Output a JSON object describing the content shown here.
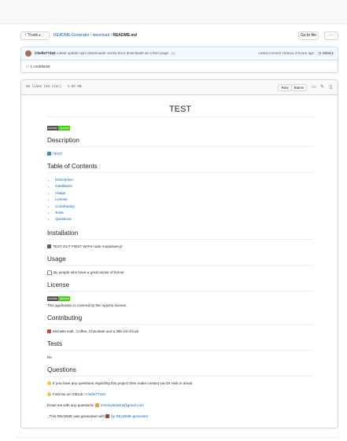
{
  "breadcrumb": {
    "branch_label": "Trunk",
    "repo": "README-Generator",
    "folder": "download",
    "file": "README.md",
    "separator": "/"
  },
  "toolbar": {
    "go_to_file": "Go to file",
    "more": "···"
  },
  "commit": {
    "author": "Chelle77322",
    "message": "Latest update npm downloader works but it downloads as a html page",
    "ellipsis": "…",
    "latest": "Latest commit 7d4a1a 3 hours ago",
    "history": "History"
  },
  "contributors": "1 contributor",
  "file": {
    "info": "56 lines (52 sloc)   1.89 KB",
    "raw": "Raw",
    "blame": "Blame"
  },
  "icons": {
    "branch": "branch-icon",
    "contributor": "people-icon",
    "history": "clock-icon",
    "display": "monitor-icon",
    "edit": "pencil-icon",
    "delete": "trash-icon"
  },
  "readme": {
    "title": "TEST",
    "badge_left": "license",
    "badge_right": "Apache",
    "h_description": "Description",
    "description": "TEST",
    "h_toc": "Table of Contents",
    "toc": [
      "Description",
      "Installation",
      "Usage",
      "License",
      "Contributing",
      "Tests",
      "Questions"
    ],
    "h_installation": "Installation",
    "installation": "TEST OUT FIRST WITH node markdown.js",
    "h_usage": "Usage",
    "usage": "By people who have a great sense of humor",
    "h_license": "License",
    "license_badge_left": "license",
    "license_badge_right": "Apache",
    "license_text": "This application is covered by the Apache license.",
    "h_contributing": "Contributing",
    "contributing": "Michelle Hall , Coffee, Chocolate and a little bit of luck",
    "h_tests": "Tests",
    "tests": "No",
    "h_questions": "Questions",
    "q1": "If you have any questions regarding this project then make contact via Git Hub or email.",
    "q2_prefix": "Find me on GitHub:",
    "q2_link": "Chelle77322",
    "q3_prefix": "Email me with any questions:",
    "q3_link": "mimmytedarra@gmail.com",
    "q4_prefix": "_This README was generated with",
    "q4_link": "by README-generator"
  },
  "colors": {
    "link": "#0366d6",
    "badge_left": "#555555",
    "badge_right": "#44cc11",
    "commit_bg": "#f1f8ff"
  }
}
